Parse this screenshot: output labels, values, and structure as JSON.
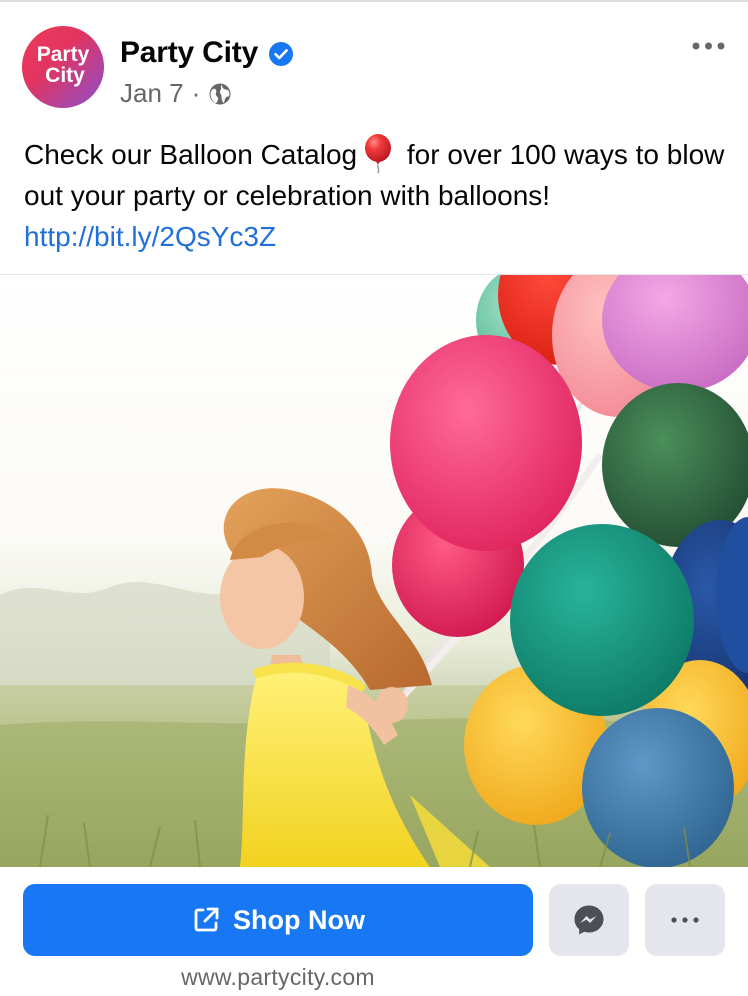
{
  "post": {
    "page_name": "Party City",
    "avatar_text_line1": "Party",
    "avatar_text_line2": "City",
    "date": "Jan 7",
    "separator": "·",
    "icons": {
      "verified": "verified-badge-icon",
      "audience": "globe-icon",
      "menu": "more-horizontal-icon",
      "emoji": "red-balloon-emoji"
    },
    "text_before_emoji": "Check our Balloon Catalog",
    "text_after_emoji": " for over 100 ways to blow out your party or celebration with balloons!",
    "link": "http://bit.ly/2QsYc3Z"
  },
  "cta": {
    "shop_label": "Shop Now",
    "domain": "www.partycity.com",
    "icons": {
      "shop": "external-link-icon",
      "message": "messenger-icon",
      "more": "more-horizontal-icon"
    }
  },
  "colors": {
    "accent": "#1877f2",
    "link": "#216fdb",
    "secondary_text": "#65676b",
    "button_gray": "#e4e6eb"
  }
}
